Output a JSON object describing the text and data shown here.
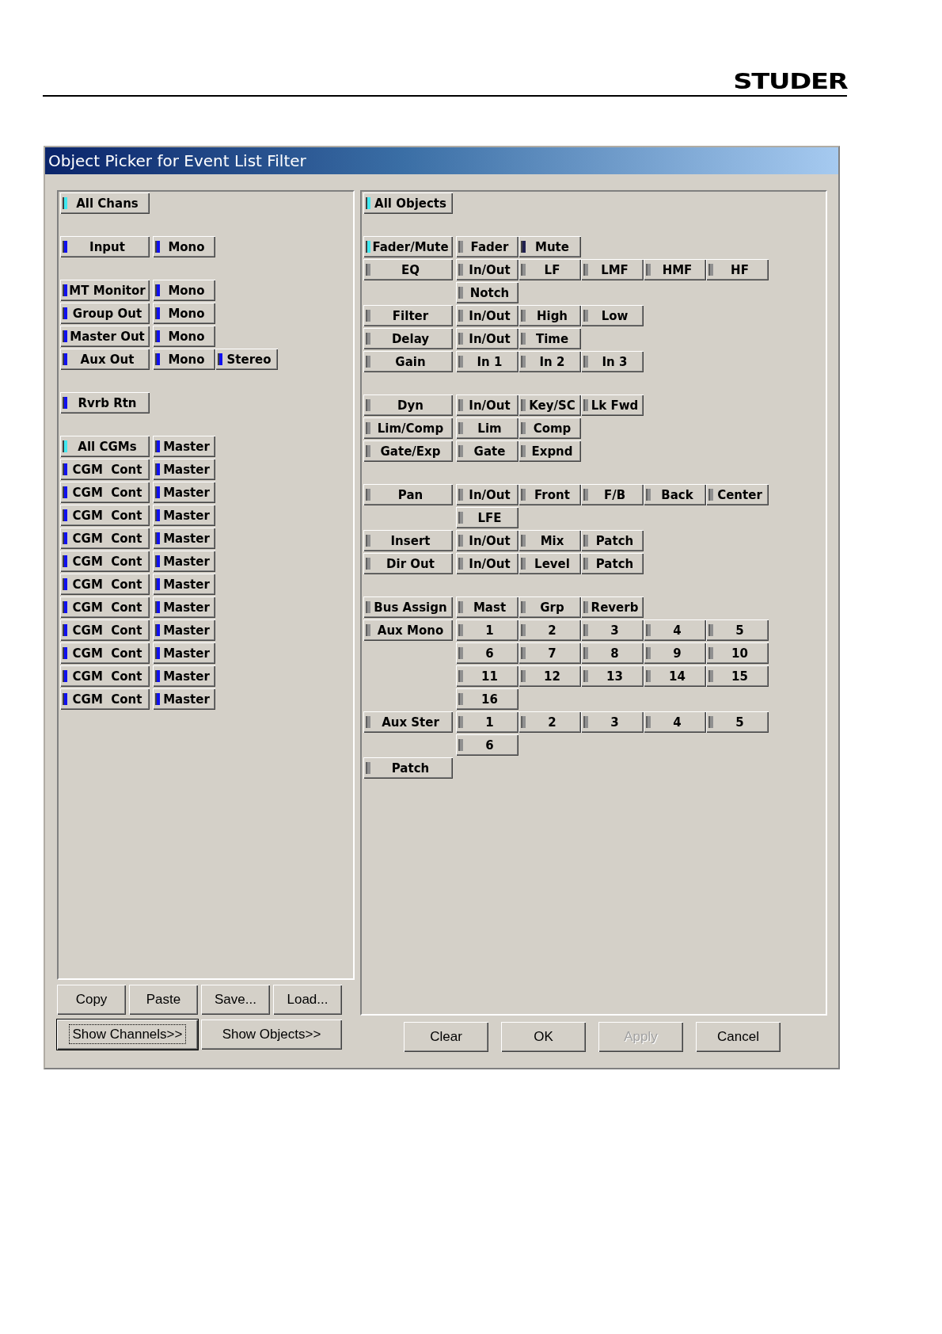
{
  "page_header": {
    "logo": "STUDER"
  },
  "window": {
    "title": "Object Picker for Event List Filter"
  },
  "channels_panel": {
    "groups": [
      {
        "rows": [
          {
            "head": {
              "label": "All Chans",
              "on": false,
              "mixed": true
            },
            "items": []
          }
        ]
      },
      {
        "rows": [
          {
            "head": {
              "label": "Input",
              "on": true,
              "mixed": false
            },
            "items": [
              {
                "label": "Mono",
                "on": true,
                "mixed": false
              }
            ]
          }
        ]
      },
      {
        "rows": [
          {
            "head": {
              "label": "MT Monitor",
              "on": true,
              "mixed": false
            },
            "items": [
              {
                "label": "Mono",
                "on": true,
                "mixed": false
              }
            ]
          },
          {
            "head": {
              "label": "Group Out",
              "on": true,
              "mixed": false
            },
            "items": [
              {
                "label": "Mono",
                "on": true,
                "mixed": false
              }
            ]
          },
          {
            "head": {
              "label": "Master Out",
              "on": true,
              "mixed": false
            },
            "items": [
              {
                "label": "Mono",
                "on": true,
                "mixed": false
              }
            ]
          },
          {
            "head": {
              "label": "Aux Out",
              "on": true,
              "mixed": false
            },
            "items": [
              {
                "label": "Mono",
                "on": true,
                "mixed": false
              },
              {
                "label": "Stereo",
                "on": true,
                "mixed": false
              }
            ]
          }
        ]
      },
      {
        "rows": [
          {
            "head": {
              "label": "Rvrb Rtn",
              "on": true,
              "mixed": false
            },
            "items": []
          }
        ]
      },
      {
        "rows": [
          {
            "head": {
              "label": "All CGMs",
              "on": false,
              "mixed": true
            },
            "items": [
              {
                "label": "Master",
                "on": true,
                "mixed": false
              }
            ]
          },
          {
            "head": {
              "label": "CGM  Cont",
              "on": true,
              "mixed": false
            },
            "items": [
              {
                "label": "Master",
                "on": true,
                "mixed": false
              }
            ]
          },
          {
            "head": {
              "label": "CGM  Cont",
              "on": true,
              "mixed": false
            },
            "items": [
              {
                "label": "Master",
                "on": true,
                "mixed": false
              }
            ]
          },
          {
            "head": {
              "label": "CGM  Cont",
              "on": true,
              "mixed": false
            },
            "items": [
              {
                "label": "Master",
                "on": true,
                "mixed": false
              }
            ]
          },
          {
            "head": {
              "label": "CGM  Cont",
              "on": true,
              "mixed": false
            },
            "items": [
              {
                "label": "Master",
                "on": true,
                "mixed": false
              }
            ]
          },
          {
            "head": {
              "label": "CGM  Cont",
              "on": true,
              "mixed": false
            },
            "items": [
              {
                "label": "Master",
                "on": true,
                "mixed": false
              }
            ]
          },
          {
            "head": {
              "label": "CGM  Cont",
              "on": true,
              "mixed": false
            },
            "items": [
              {
                "label": "Master",
                "on": true,
                "mixed": false
              }
            ]
          },
          {
            "head": {
              "label": "CGM  Cont",
              "on": true,
              "mixed": false
            },
            "items": [
              {
                "label": "Master",
                "on": true,
                "mixed": false
              }
            ]
          },
          {
            "head": {
              "label": "CGM  Cont",
              "on": true,
              "mixed": false
            },
            "items": [
              {
                "label": "Master",
                "on": true,
                "mixed": false
              }
            ]
          },
          {
            "head": {
              "label": "CGM  Cont",
              "on": true,
              "mixed": false
            },
            "items": [
              {
                "label": "Master",
                "on": true,
                "mixed": false
              }
            ]
          },
          {
            "head": {
              "label": "CGM  Cont",
              "on": true,
              "mixed": false
            },
            "items": [
              {
                "label": "Master",
                "on": true,
                "mixed": false
              }
            ]
          },
          {
            "head": {
              "label": "CGM  Cont",
              "on": true,
              "mixed": false
            },
            "items": [
              {
                "label": "Master",
                "on": true,
                "mixed": false
              }
            ]
          }
        ]
      }
    ]
  },
  "objects_panel": {
    "groups": [
      {
        "rows": [
          {
            "head": {
              "label": "All Objects",
              "on": false,
              "mixed": true
            },
            "items": []
          }
        ]
      },
      {
        "rows": [
          {
            "head": {
              "label": "Fader/Mute",
              "on": false,
              "mixed": true
            },
            "items": [
              {
                "label": "Fader",
                "on": false,
                "mixed": false
              },
              {
                "label": "Mute",
                "on": true,
                "mixed": false
              }
            ]
          },
          {
            "head": {
              "label": "EQ",
              "on": false,
              "mixed": false
            },
            "items": [
              {
                "label": "In/Out",
                "on": false,
                "mixed": false
              },
              {
                "label": "LF",
                "on": false,
                "mixed": false
              },
              {
                "label": "LMF",
                "on": false,
                "mixed": false
              },
              {
                "label": "HMF",
                "on": false,
                "mixed": false
              },
              {
                "label": "HF",
                "on": false,
                "mixed": false
              }
            ]
          },
          {
            "items": [
              {
                "label": "Notch",
                "on": false,
                "mixed": false
              }
            ]
          },
          {
            "head": {
              "label": "Filter",
              "on": false,
              "mixed": false
            },
            "items": [
              {
                "label": "In/Out",
                "on": false,
                "mixed": false
              },
              {
                "label": "High",
                "on": false,
                "mixed": false
              },
              {
                "label": "Low",
                "on": false,
                "mixed": false
              }
            ]
          },
          {
            "head": {
              "label": "Delay",
              "on": false,
              "mixed": false
            },
            "items": [
              {
                "label": "In/Out",
                "on": false,
                "mixed": false
              },
              {
                "label": "Time",
                "on": false,
                "mixed": false
              }
            ]
          },
          {
            "head": {
              "label": "Gain",
              "on": false,
              "mixed": false
            },
            "items": [
              {
                "label": "In 1",
                "on": false,
                "mixed": false
              },
              {
                "label": "In 2",
                "on": false,
                "mixed": false
              },
              {
                "label": "In 3",
                "on": false,
                "mixed": false
              }
            ]
          }
        ]
      },
      {
        "rows": [
          {
            "head": {
              "label": "Dyn",
              "on": false,
              "mixed": false
            },
            "items": [
              {
                "label": "In/Out",
                "on": false,
                "mixed": false
              },
              {
                "label": "Key/SC",
                "on": false,
                "mixed": false
              },
              {
                "label": "Lk Fwd",
                "on": false,
                "mixed": false
              }
            ]
          },
          {
            "head": {
              "label": "Lim/Comp",
              "on": false,
              "mixed": false
            },
            "items": [
              {
                "label": "Lim",
                "on": false,
                "mixed": false
              },
              {
                "label": "Comp",
                "on": false,
                "mixed": false
              }
            ]
          },
          {
            "head": {
              "label": "Gate/Exp",
              "on": false,
              "mixed": false
            },
            "items": [
              {
                "label": "Gate",
                "on": false,
                "mixed": false
              },
              {
                "label": "Expnd",
                "on": false,
                "mixed": false
              }
            ]
          }
        ]
      },
      {
        "rows": [
          {
            "head": {
              "label": "Pan",
              "on": false,
              "mixed": false
            },
            "items": [
              {
                "label": "In/Out",
                "on": false,
                "mixed": false
              },
              {
                "label": "Front",
                "on": false,
                "mixed": false
              },
              {
                "label": "F/B",
                "on": false,
                "mixed": false
              },
              {
                "label": "Back",
                "on": false,
                "mixed": false
              },
              {
                "label": "Center",
                "on": false,
                "mixed": false
              }
            ]
          },
          {
            "items": [
              {
                "label": "LFE",
                "on": false,
                "mixed": false
              }
            ]
          },
          {
            "head": {
              "label": "Insert",
              "on": false,
              "mixed": false
            },
            "items": [
              {
                "label": "In/Out",
                "on": false,
                "mixed": false
              },
              {
                "label": "Mix",
                "on": false,
                "mixed": false
              },
              {
                "label": "Patch",
                "on": false,
                "mixed": false
              }
            ]
          },
          {
            "head": {
              "label": "Dir Out",
              "on": false,
              "mixed": false
            },
            "items": [
              {
                "label": "In/Out",
                "on": false,
                "mixed": false
              },
              {
                "label": "Level",
                "on": false,
                "mixed": false
              },
              {
                "label": "Patch",
                "on": false,
                "mixed": false
              }
            ]
          }
        ]
      },
      {
        "rows": [
          {
            "head": {
              "label": "Bus Assign",
              "on": false,
              "mixed": false
            },
            "items": [
              {
                "label": "Mast",
                "on": false,
                "mixed": false
              },
              {
                "label": "Grp",
                "on": false,
                "mixed": false
              },
              {
                "label": "Reverb",
                "on": false,
                "mixed": false
              }
            ]
          },
          {
            "head": {
              "label": "Aux Mono",
              "on": false,
              "mixed": false
            },
            "items": [
              {
                "label": "1",
                "on": false,
                "mixed": false
              },
              {
                "label": "2",
                "on": false,
                "mixed": false
              },
              {
                "label": "3",
                "on": false,
                "mixed": false
              },
              {
                "label": "4",
                "on": false,
                "mixed": false
              },
              {
                "label": "5",
                "on": false,
                "mixed": false
              }
            ]
          },
          {
            "items": [
              {
                "label": "6",
                "on": false,
                "mixed": false
              },
              {
                "label": "7",
                "on": false,
                "mixed": false
              },
              {
                "label": "8",
                "on": false,
                "mixed": false
              },
              {
                "label": "9",
                "on": false,
                "mixed": false
              },
              {
                "label": "10",
                "on": false,
                "mixed": false
              }
            ]
          },
          {
            "items": [
              {
                "label": "11",
                "on": false,
                "mixed": false
              },
              {
                "label": "12",
                "on": false,
                "mixed": false
              },
              {
                "label": "13",
                "on": false,
                "mixed": false
              },
              {
                "label": "14",
                "on": false,
                "mixed": false
              },
              {
                "label": "15",
                "on": false,
                "mixed": false
              }
            ]
          },
          {
            "items": [
              {
                "label": "16",
                "on": false,
                "mixed": false
              }
            ]
          },
          {
            "head": {
              "label": "Aux Ster",
              "on": false,
              "mixed": false
            },
            "items": [
              {
                "label": "1",
                "on": false,
                "mixed": false
              },
              {
                "label": "2",
                "on": false,
                "mixed": false
              },
              {
                "label": "3",
                "on": false,
                "mixed": false
              },
              {
                "label": "4",
                "on": false,
                "mixed": false
              },
              {
                "label": "5",
                "on": false,
                "mixed": false
              }
            ]
          },
          {
            "items": [
              {
                "label": "6",
                "on": false,
                "mixed": false
              }
            ]
          },
          {
            "head": {
              "label": "Patch",
              "on": false,
              "mixed": false
            },
            "items": []
          }
        ]
      }
    ]
  },
  "clipboard_buttons": [
    {
      "label": "Copy"
    },
    {
      "label": "Paste"
    },
    {
      "label": "Save..."
    },
    {
      "label": "Load..."
    }
  ],
  "view_buttons": [
    {
      "label": "Show Channels>>",
      "default": true
    },
    {
      "label": "Show Objects>>",
      "default": false
    }
  ],
  "action_buttons": [
    {
      "label": "Clear",
      "disabled": false
    },
    {
      "label": "OK",
      "disabled": false
    },
    {
      "label": "Apply",
      "disabled": true
    },
    {
      "label": "Cancel",
      "disabled": false
    }
  ]
}
